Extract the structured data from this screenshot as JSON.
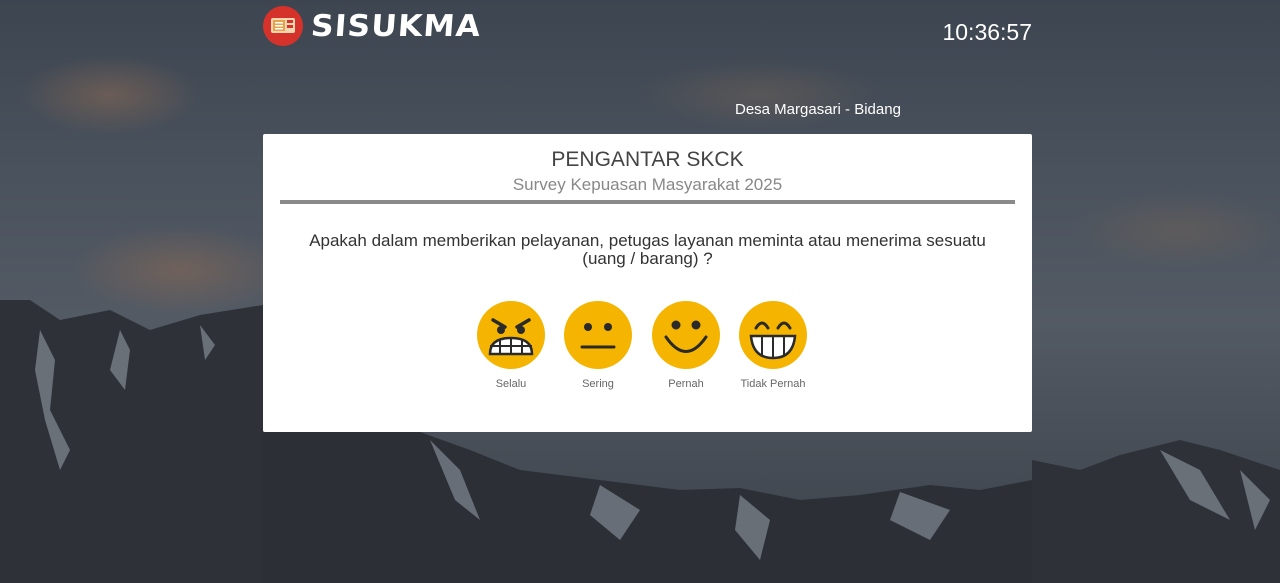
{
  "app": {
    "logo_text": "SISUKMA",
    "clock": "10:36:57",
    "location": "Desa Margasari - Bidang"
  },
  "card": {
    "title": "PENGANTAR SKCK",
    "subtitle": "Survey Kepuasan Masyarakat 2025",
    "question": "Apakah dalam memberikan pelayanan, petugas layanan meminta atau menerima sesuatu (uang / barang) ?"
  },
  "options": [
    {
      "label": "Selalu",
      "icon": "angry-face-icon"
    },
    {
      "label": "Sering",
      "icon": "neutral-face-icon"
    },
    {
      "label": "Pernah",
      "icon": "smiling-face-icon"
    },
    {
      "label": "Tidak Pernah",
      "icon": "grinning-face-icon"
    }
  ],
  "colors": {
    "emoji": "#f4b400",
    "logo_red": "#d6322c",
    "card": "#ffffff"
  }
}
